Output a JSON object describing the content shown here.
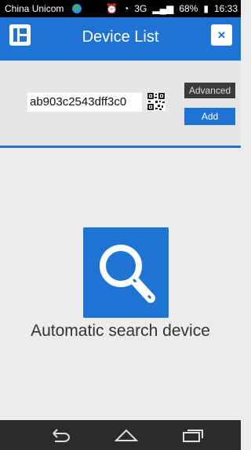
{
  "status_bar": {
    "carrier": "China Unicom",
    "network": "3G",
    "battery": "68%",
    "time": "16:33"
  },
  "title_bar": {
    "title": "Device List",
    "close_label": "×"
  },
  "device": {
    "id_value": "ab903c2543dff3c0"
  },
  "buttons": {
    "advanced": "Advanced",
    "add": "Add"
  },
  "search": {
    "label": "Automatic search device"
  },
  "colors": {
    "accent": "#1e73d3",
    "background": "#ececec",
    "nav_bar": "#2b2b2b"
  },
  "icons": [
    "menu-icon",
    "close-icon",
    "qr-code-icon",
    "search-icon",
    "back-icon",
    "home-icon",
    "recent-apps-icon"
  ]
}
